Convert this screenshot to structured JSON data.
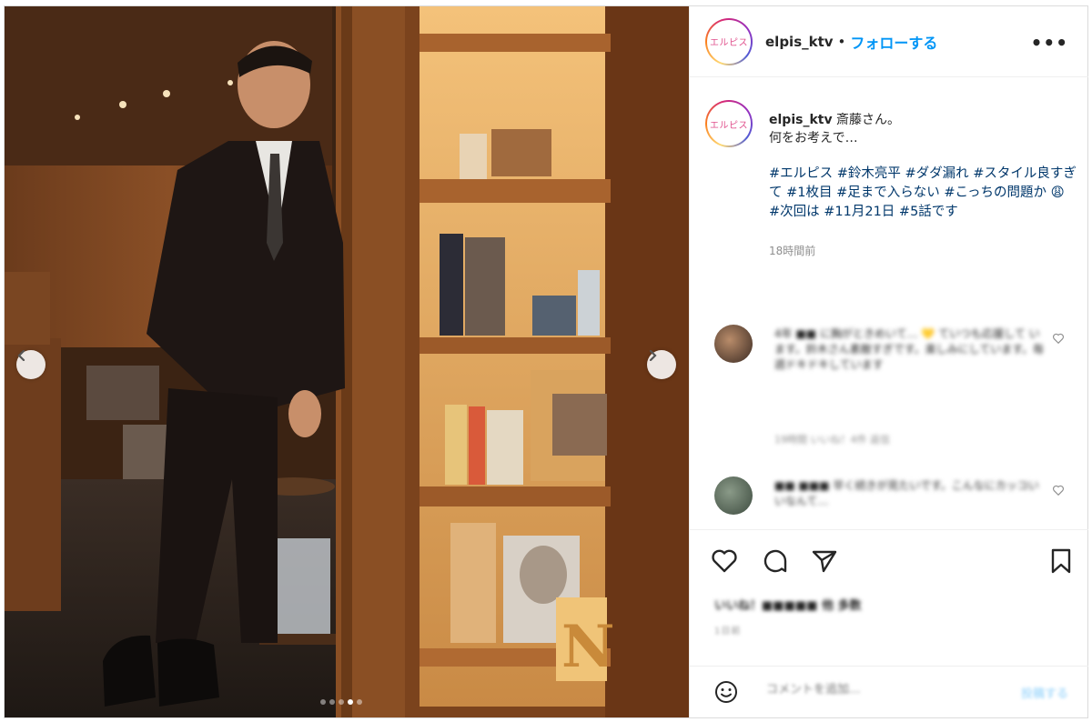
{
  "colors": {
    "accent": "#0095f6",
    "hashtag": "#00376b",
    "muted": "#8e8e8e"
  },
  "post_header": {
    "avatar_text": "エルピス",
    "username": "elpis_ktv",
    "separator": "•",
    "follow_label": "フォローする",
    "more_icon": "more-dots-icon",
    "more_glyph": "•••"
  },
  "caption": {
    "avatar_text": "エルピス",
    "username": "elpis_ktv",
    "line1": "斎藤さん。",
    "line2": "何をお考えで…",
    "hashtags": "#エルピス #鈴木亮平 #ダダ漏れ #スタイル良すぎて #1枚目 #足まで入らない #こっちの問題か 😩 #次回は #11月21日 #5話です",
    "time_ago": "18時間前"
  },
  "comments": [
    {
      "text": "4年 ■■ に胸がときめいて… 💛 ていつも応援して います。鈴木さん素敵すぎです。楽しみにしています。毎週ドキドキしています",
      "meta": "19時間  いいね！4件  返信",
      "avatar_icon": "commenter-avatar-1"
    },
    {
      "text": "■■ ■■■ 早く続きが見たいです。こんなにカッコいいなんて…",
      "meta": "",
      "avatar_icon": "commenter-avatar-2"
    }
  ],
  "actions": {
    "like_icon": "heart-icon",
    "comment_icon": "comment-icon",
    "share_icon": "share-icon",
    "save_icon": "bookmark-icon",
    "likes_text": "いいね！■■■■■ 他 多数",
    "date_text": "1日前"
  },
  "add_comment": {
    "emoji_icon": "emoji-icon",
    "placeholder": "コメントを追加...",
    "post_label": "投稿する"
  },
  "carousel": {
    "prev_icon": "chevron-left-icon",
    "next_icon": "chevron-right-icon",
    "slide_count": 5,
    "active_index": 3
  }
}
